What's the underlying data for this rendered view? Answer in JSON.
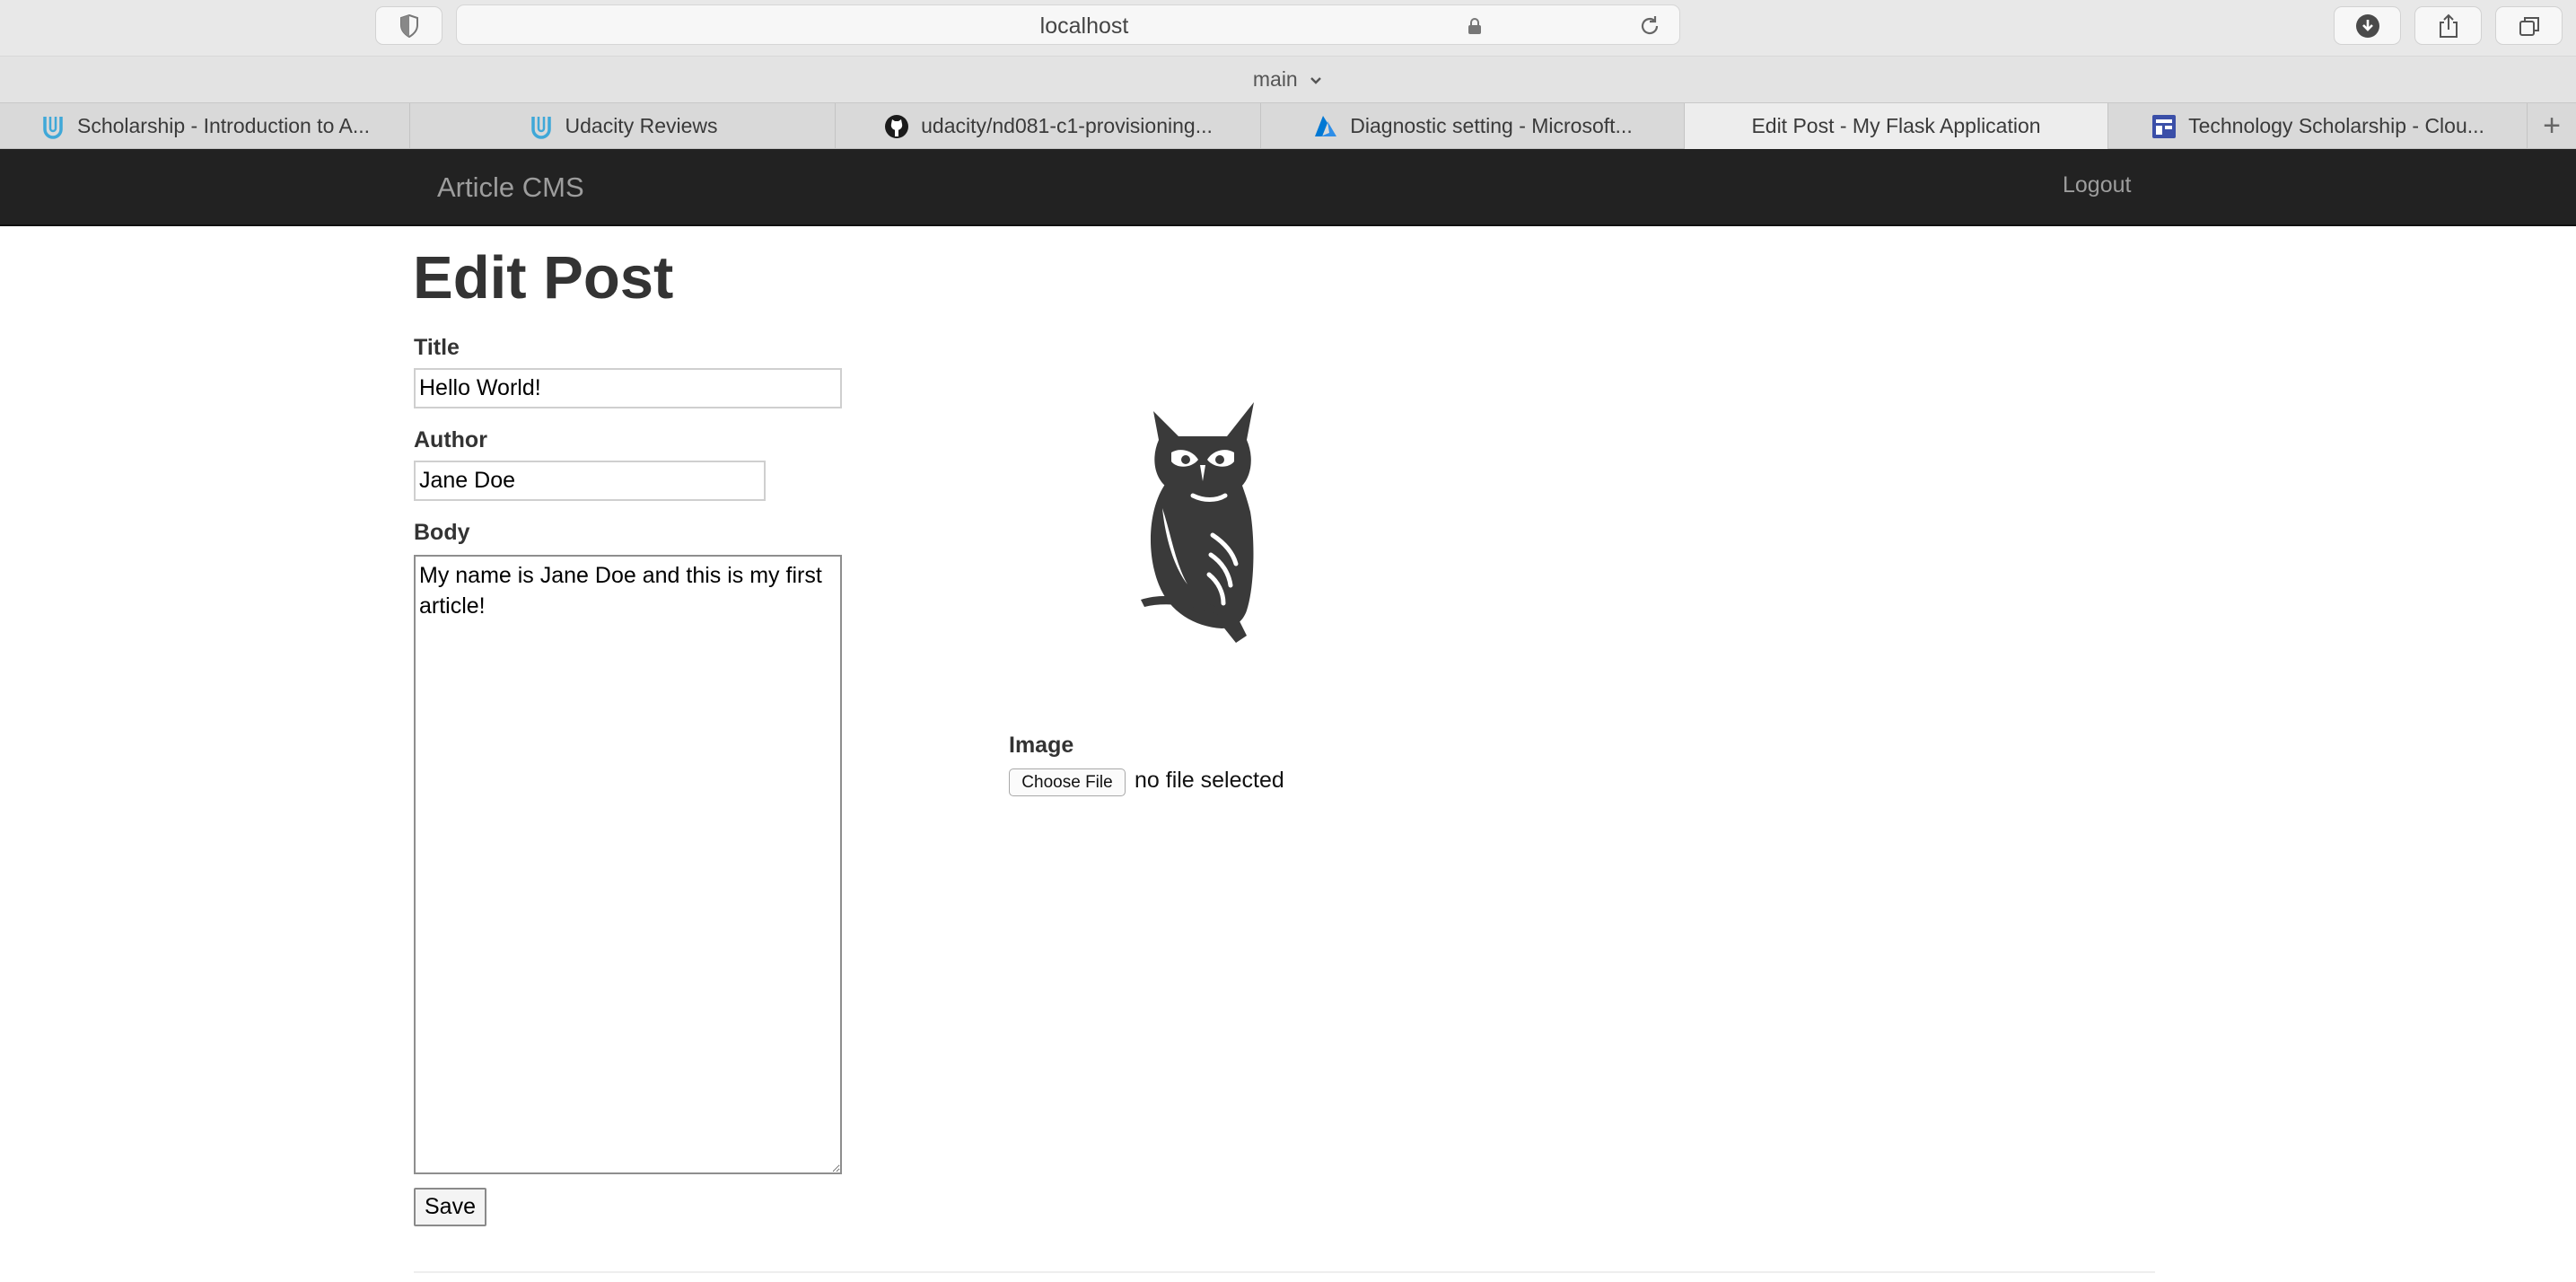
{
  "browser": {
    "url": "localhost",
    "branch": "main",
    "tabs": [
      {
        "label": "Scholarship - Introduction to A...",
        "icon": "udacity-icon",
        "active": false
      },
      {
        "label": "Udacity Reviews",
        "icon": "udacity-icon",
        "active": false
      },
      {
        "label": "udacity/nd081-c1-provisioning...",
        "icon": "github-icon",
        "active": false
      },
      {
        "label": "Diagnostic setting - Microsoft...",
        "icon": "azure-icon",
        "active": false
      },
      {
        "label": "Edit Post - My Flask Application",
        "icon": "",
        "active": true
      },
      {
        "label": "Technology Scholarship - Clou...",
        "icon": "page-layout-icon",
        "active": false
      }
    ]
  },
  "navbar": {
    "brand": "Article CMS",
    "logout": "Logout"
  },
  "form": {
    "heading": "Edit Post",
    "title_label": "Title",
    "title_value": "Hello World!",
    "author_label": "Author",
    "author_value": "Jane Doe",
    "body_label": "Body",
    "body_value": "My name is Jane Doe and this is my first article!",
    "image_label": "Image",
    "choose_file": "Choose File",
    "no_file": "no file selected",
    "save": "Save"
  },
  "colors": {
    "navbar_bg": "#222222",
    "navbar_text": "#9d9d9d",
    "heading": "#333333"
  }
}
